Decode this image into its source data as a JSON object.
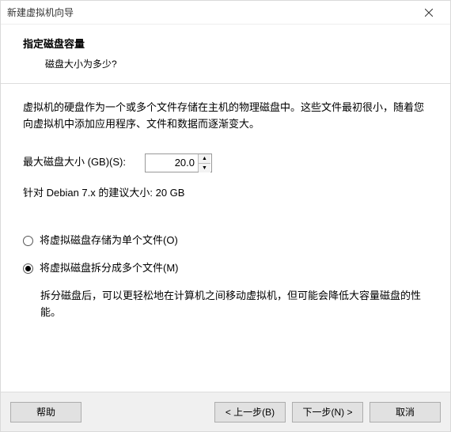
{
  "window": {
    "title": "新建虚拟机向导"
  },
  "header": {
    "title": "指定磁盘容量",
    "subtitle": "磁盘大小为多少?"
  },
  "content": {
    "description": "虚拟机的硬盘作为一个或多个文件存储在主机的物理磁盘中。这些文件最初很小，随着您向虚拟机中添加应用程序、文件和数据而逐渐变大。",
    "max_disk_label": "最大磁盘大小 (GB)(S):",
    "max_disk_value": "20.0",
    "recommend": "针对 Debian 7.x 的建议大小: 20 GB",
    "option_single": "将虚拟磁盘存储为单个文件(O)",
    "option_split": "将虚拟磁盘拆分成多个文件(M)",
    "split_desc": "拆分磁盘后，可以更轻松地在计算机之间移动虚拟机，但可能会降低大容量磁盘的性能。",
    "selected": "split"
  },
  "footer": {
    "help": "帮助",
    "back": "< 上一步(B)",
    "next": "下一步(N) >",
    "cancel": "取消"
  }
}
